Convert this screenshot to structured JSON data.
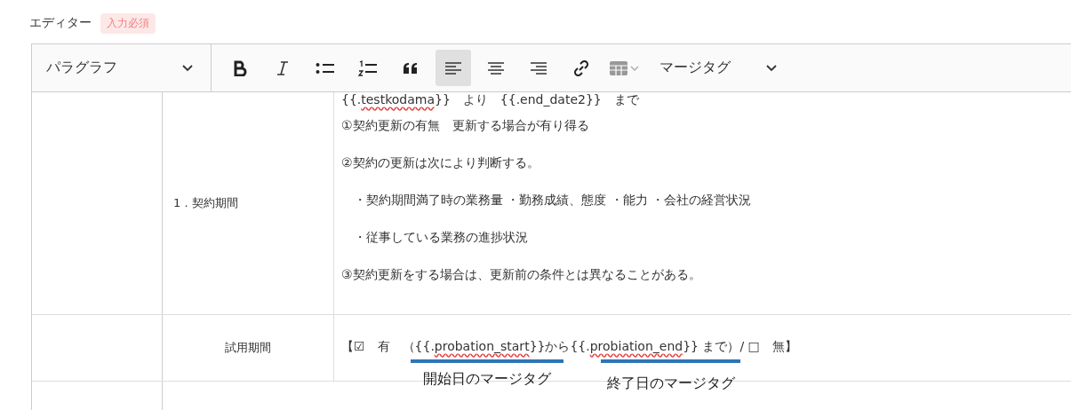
{
  "editor": {
    "label": "エディター",
    "required_badge": "入力必須"
  },
  "toolbar": {
    "paragraph_select": "パラグラフ",
    "merge_tag_select": "マージタグ",
    "buttons": [
      {
        "kind": "bold",
        "selected": false
      },
      {
        "kind": "italic",
        "selected": false
      },
      {
        "kind": "bullet-list",
        "selected": false
      },
      {
        "kind": "numbered-list",
        "selected": false
      },
      {
        "kind": "quote",
        "selected": false
      },
      {
        "kind": "align-left",
        "selected": true
      },
      {
        "kind": "align-center",
        "selected": false
      },
      {
        "kind": "align-right",
        "selected": false
      },
      {
        "kind": "link",
        "selected": false
      },
      {
        "kind": "table",
        "selected": false
      }
    ]
  },
  "table": {
    "rows": [
      {
        "label": "1．契約期間",
        "kind": "section",
        "lines": [
          {
            "segments": [
              {
                "parts": [
                  {
                    "text": "{{.",
                    "misspelled": false
                  },
                  {
                    "text": "testkodama",
                    "misspelled": true
                  },
                  {
                    "text": "}}　より　{{.end_date2}}　まで",
                    "misspelled": false
                  }
                ]
              }
            ]
          },
          {
            "segments": [
              {
                "parts": [
                  {
                    "text": "①契約更新の有無　更新する場合が有り得る",
                    "misspelled": false
                  }
                ]
              }
            ]
          },
          {
            "segments": [
              {
                "parts": [
                  {
                    "text": "②契約の更新は次により判断する。",
                    "misspelled": false
                  }
                ]
              }
            ]
          },
          {
            "segments": [
              {
                "parts": [
                  {
                    "text": "　・契約期間満了時の業務量 ・勤務成績、態度 ・能力 ・会社の経営状況",
                    "misspelled": false
                  }
                ]
              }
            ]
          },
          {
            "segments": [
              {
                "parts": [
                  {
                    "text": "　・従事している業務の進捗状況",
                    "misspelled": false
                  }
                ]
              }
            ]
          },
          {
            "segments": [
              {
                "parts": [
                  {
                    "text": "③契約更新をする場合は、更新前の条件とは異なることがある。",
                    "misspelled": false
                  }
                ]
              }
            ]
          }
        ]
      },
      {
        "label": "試用期間",
        "kind": "item",
        "lines": [
          {
            "segments": [
              {
                "parts": [
                  {
                    "text": "【☑　有　",
                    "misspelled": false
                  }
                ]
              },
              {
                "annotation": "開始日のマージタグ",
                "parts": [
                  {
                    "text": "（{{.",
                    "misspelled": false
                  },
                  {
                    "text": "probation_start",
                    "misspelled": true
                  },
                  {
                    "text": "}}",
                    "misspelled": false
                  }
                ]
              },
              {
                "parts": [
                  {
                    "text": "から",
                    "misspelled": false
                  }
                ]
              },
              {
                "annotation": "終了日のマージタグ",
                "parts": [
                  {
                    "text": "{{.",
                    "misspelled": false
                  },
                  {
                    "text": "probiation_end",
                    "misspelled": true
                  },
                  {
                    "text": "}}",
                    "misspelled": false
                  }
                ]
              },
              {
                "parts": [
                  {
                    "text": " まで）/ □　無】",
                    "misspelled": false
                  }
                ]
              }
            ]
          }
        ]
      }
    ]
  }
}
